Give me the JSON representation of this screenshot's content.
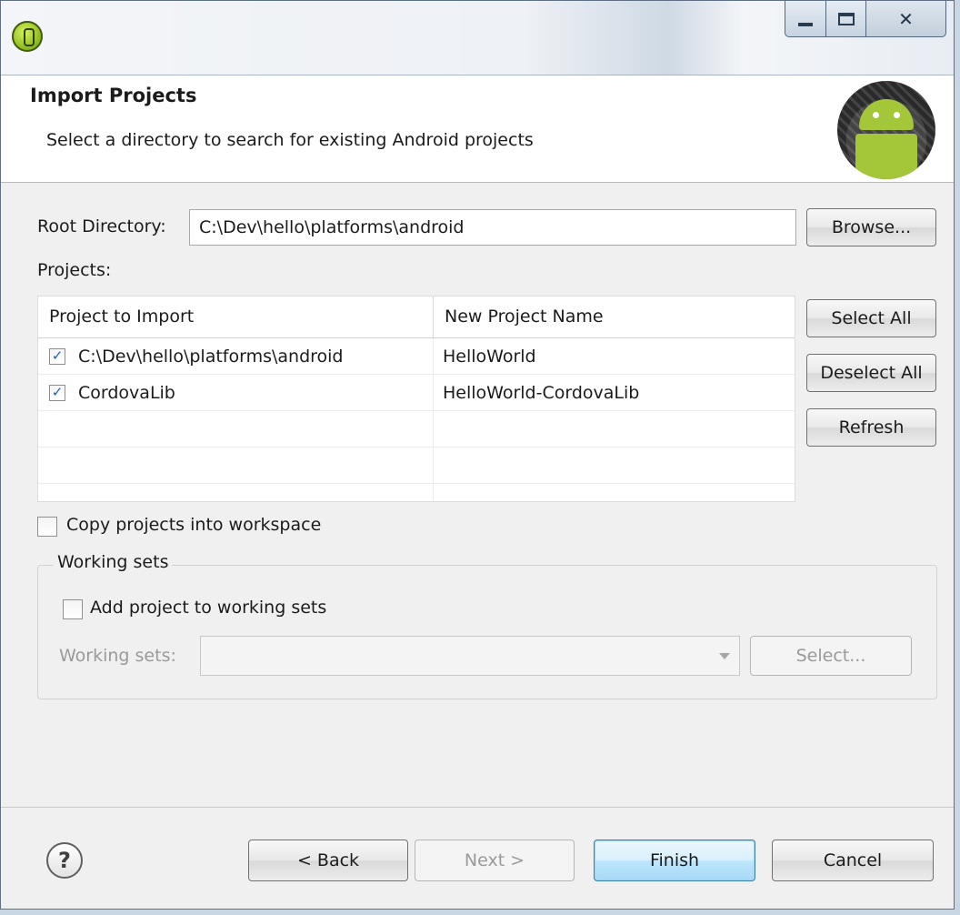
{
  "header": {
    "title": "Import Projects",
    "description": "Select a directory to search for existing Android projects"
  },
  "root_directory": {
    "label": "Root Directory:",
    "value": "C:\\Dev\\hello\\platforms\\android",
    "browse_label": "Browse..."
  },
  "projects": {
    "label": "Projects:",
    "columns": [
      "Project to Import",
      "New Project Name"
    ],
    "rows": [
      {
        "checked": true,
        "project": "C:\\Dev\\hello\\platforms\\android",
        "name": "HelloWorld"
      },
      {
        "checked": true,
        "project": "CordovaLib",
        "name": "HelloWorld-CordovaLib"
      }
    ],
    "select_all_label": "Select All",
    "deselect_all_label": "Deselect All",
    "refresh_label": "Refresh"
  },
  "copy_into_workspace": {
    "label": "Copy projects into workspace",
    "checked": false
  },
  "working_sets": {
    "legend": "Working sets",
    "add_label": "Add project to working sets",
    "add_checked": false,
    "combo_label": "Working sets:",
    "combo_value": "",
    "select_label": "Select..."
  },
  "footer": {
    "help_glyph": "?",
    "back_label": "< Back",
    "next_label": "Next >",
    "finish_label": "Finish",
    "cancel_label": "Cancel"
  },
  "icons": {
    "app": "eclipse-adt-icon",
    "logo": "android-logo",
    "help": "help-icon"
  }
}
